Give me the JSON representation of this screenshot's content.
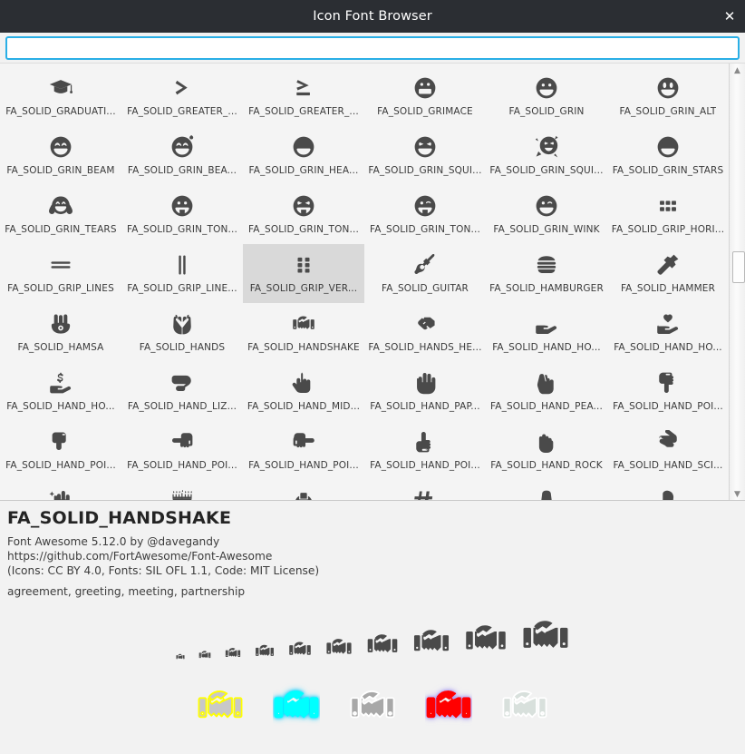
{
  "window": {
    "title": "Icon Font Browser",
    "close_label": "✕"
  },
  "search": {
    "value": "",
    "placeholder": ""
  },
  "scrollbar": {
    "up_arrow": "▲",
    "down_arrow": "▼"
  },
  "grid": {
    "selected_index": 20,
    "items": [
      {
        "label": "FA_SOLID_GRADUATI...",
        "icon": "graduation-cap-icon"
      },
      {
        "label": "FA_SOLID_GREATER_...",
        "icon": "greater-than-icon"
      },
      {
        "label": "FA_SOLID_GREATER_...",
        "icon": "greater-than-equal-icon"
      },
      {
        "label": "FA_SOLID_GRIMACE",
        "icon": "grimace-icon"
      },
      {
        "label": "FA_SOLID_GRIN",
        "icon": "grin-icon"
      },
      {
        "label": "FA_SOLID_GRIN_ALT",
        "icon": "grin-alt-icon"
      },
      {
        "label": "FA_SOLID_GRIN_BEAM",
        "icon": "grin-beam-icon"
      },
      {
        "label": "FA_SOLID_GRIN_BEA...",
        "icon": "grin-beam-sweat-icon"
      },
      {
        "label": "FA_SOLID_GRIN_HEA...",
        "icon": "grin-hearts-icon"
      },
      {
        "label": "FA_SOLID_GRIN_SQUI...",
        "icon": "grin-squint-icon"
      },
      {
        "label": "FA_SOLID_GRIN_SQUI...",
        "icon": "grin-squint-tears-icon"
      },
      {
        "label": "FA_SOLID_GRIN_STARS",
        "icon": "grin-stars-icon"
      },
      {
        "label": "FA_SOLID_GRIN_TEARS",
        "icon": "grin-tears-icon"
      },
      {
        "label": "FA_SOLID_GRIN_TON...",
        "icon": "grin-tongue-icon"
      },
      {
        "label": "FA_SOLID_GRIN_TON...",
        "icon": "grin-tongue-squint-icon"
      },
      {
        "label": "FA_SOLID_GRIN_TON...",
        "icon": "grin-tongue-wink-icon"
      },
      {
        "label": "FA_SOLID_GRIN_WINK",
        "icon": "grin-wink-icon"
      },
      {
        "label": "FA_SOLID_GRIP_HORI...",
        "icon": "grip-horizontal-icon"
      },
      {
        "label": "FA_SOLID_GRIP_LINES",
        "icon": "grip-lines-icon"
      },
      {
        "label": "FA_SOLID_GRIP_LINE...",
        "icon": "grip-lines-vertical-icon"
      },
      {
        "label": "FA_SOLID_GRIP_VER...",
        "icon": "grip-vertical-icon"
      },
      {
        "label": "FA_SOLID_GUITAR",
        "icon": "guitar-icon"
      },
      {
        "label": "FA_SOLID_HAMBURGER",
        "icon": "hamburger-icon"
      },
      {
        "label": "FA_SOLID_HAMMER",
        "icon": "hammer-icon"
      },
      {
        "label": "FA_SOLID_HAMSA",
        "icon": "hamsa-icon"
      },
      {
        "label": "FA_SOLID_HANDS",
        "icon": "hands-icon"
      },
      {
        "label": "FA_SOLID_HANDSHAKE",
        "icon": "handshake-icon"
      },
      {
        "label": "FA_SOLID_HANDS_HE...",
        "icon": "hands-helping-icon"
      },
      {
        "label": "FA_SOLID_HAND_HO...",
        "icon": "hand-holding-icon"
      },
      {
        "label": "FA_SOLID_HAND_HO...",
        "icon": "hand-holding-heart-icon"
      },
      {
        "label": "FA_SOLID_HAND_HO...",
        "icon": "hand-holding-usd-icon"
      },
      {
        "label": "FA_SOLID_HAND_LIZ...",
        "icon": "hand-lizard-icon"
      },
      {
        "label": "FA_SOLID_HAND_MID...",
        "icon": "hand-middle-finger-icon"
      },
      {
        "label": "FA_SOLID_HAND_PAP...",
        "icon": "hand-paper-icon"
      },
      {
        "label": "FA_SOLID_HAND_PEA...",
        "icon": "hand-peace-icon"
      },
      {
        "label": "FA_SOLID_HAND_POI...",
        "icon": "hand-point-down-icon"
      },
      {
        "label": "FA_SOLID_HAND_POI...",
        "icon": "hand-point-down-alt-icon"
      },
      {
        "label": "FA_SOLID_HAND_POI...",
        "icon": "hand-point-left-icon"
      },
      {
        "label": "FA_SOLID_HAND_POI...",
        "icon": "hand-point-right-icon"
      },
      {
        "label": "FA_SOLID_HAND_POI...",
        "icon": "hand-point-up-icon"
      },
      {
        "label": "FA_SOLID_HAND_ROCK",
        "icon": "hand-rock-icon"
      },
      {
        "label": "FA_SOLID_HAND_SCI...",
        "icon": "hand-scissors-icon"
      },
      {
        "label": "",
        "icon": "hand-sparkles-icon"
      },
      {
        "label": "",
        "icon": "hanukiah-icon"
      },
      {
        "label": "",
        "icon": "hard-hat-icon"
      },
      {
        "label": "",
        "icon": "hashtag-icon"
      },
      {
        "label": "",
        "icon": "hat-cowboy-icon"
      },
      {
        "label": "",
        "icon": "hat-cowboy-side-icon"
      }
    ]
  },
  "detail": {
    "title": "FA_SOLID_HANDSHAKE",
    "credit": "Font Awesome 5.12.0 by @davegandy",
    "url": "https://github.com/FortAwesome/Font-Awesome",
    "license": "(Icons: CC BY 4.0, Fonts: SIL OFL 1.1, Code: MIT License)",
    "tags": "agreement, greeting, meeting, partnership",
    "preview_icon": "handshake-icon",
    "size_previews": [
      10,
      14,
      18,
      22,
      26,
      30,
      36,
      42,
      48,
      54
    ],
    "color_previews": [
      {
        "name": "yellow-outline",
        "fill": "#c8c8c8",
        "stroke": "#ffff00",
        "glow": "none"
      },
      {
        "name": "cyan-glow",
        "fill": "#00ffff",
        "stroke": "#00ffff",
        "glow": "#00ccff"
      },
      {
        "name": "gray-white-outline",
        "fill": "#a8a8a8",
        "stroke": "#ffffff",
        "glow": "none"
      },
      {
        "name": "red-purple-glow",
        "fill": "#ff0000",
        "stroke": "#ff0000",
        "glow": "#9b8cf0"
      },
      {
        "name": "light-gradient",
        "fill": "#d8e0dc",
        "stroke": "#ffffff",
        "glow": "none"
      }
    ]
  }
}
